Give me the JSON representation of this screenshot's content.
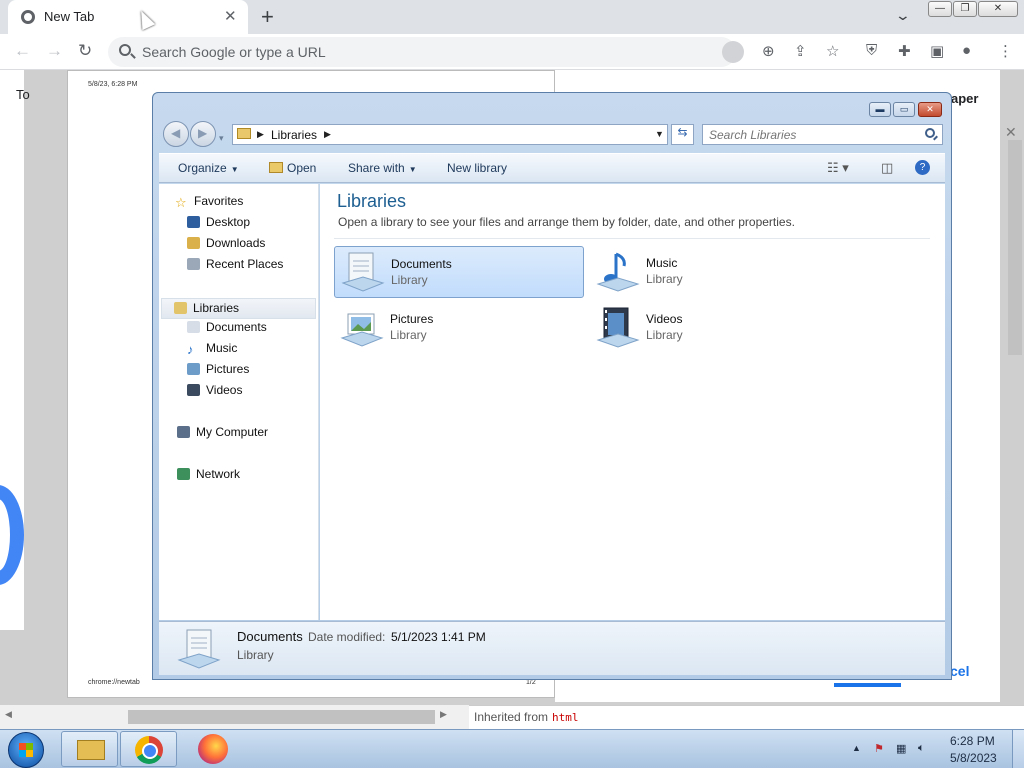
{
  "browser": {
    "tab_title": "New Tab",
    "omnibox_placeholder": "Search Google or type a URL",
    "print_preview": {
      "date_time": "5/8/23, 6:28 PM",
      "url": "chrome://newtab",
      "page_number": "1/2"
    },
    "background_dialog": {
      "paper_text": "aper",
      "cancel_text": "cel",
      "to_text": "To"
    },
    "devtools": {
      "inherited_label": "Inherited from",
      "inherited_tag": "html"
    }
  },
  "explorer": {
    "address": {
      "location": "Libraries"
    },
    "search_placeholder": "Search Libraries",
    "commands": {
      "organize": "Organize",
      "open": "Open",
      "share_with": "Share with",
      "new_library": "New library"
    },
    "nav_pane": {
      "favorites": "Favorites",
      "desktop": "Desktop",
      "downloads": "Downloads",
      "recent_places": "Recent Places",
      "libraries": "Libraries",
      "documents": "Documents",
      "music": "Music",
      "pictures": "Pictures",
      "videos": "Videos",
      "my_computer": "My Computer",
      "network": "Network"
    },
    "content": {
      "title": "Libraries",
      "description": "Open a library to see your files and arrange them by folder, date, and other properties.",
      "libraries": [
        {
          "name": "Documents",
          "type": "Library"
        },
        {
          "name": "Music",
          "type": "Library"
        },
        {
          "name": "Pictures",
          "type": "Library"
        },
        {
          "name": "Videos",
          "type": "Library"
        }
      ]
    },
    "details": {
      "name": "Documents",
      "date_label": "Date modified:",
      "date_value": "5/1/2023 1:41 PM",
      "type": "Library"
    }
  },
  "taskbar": {
    "clock_time": "6:28 PM",
    "clock_date": "5/8/2023"
  },
  "colors": {
    "accent_blue": "#1e5f92",
    "selection": "#c1dcfc",
    "chrome_blue": "#1a73e8"
  }
}
